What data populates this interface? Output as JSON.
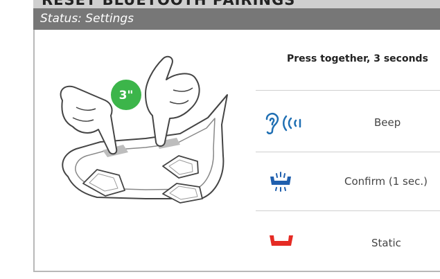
{
  "header": {
    "title": "RESET BLUETOOTH PAIRINGS",
    "status": "Status: Settings"
  },
  "illustration": {
    "timer_badge": "3\"",
    "badge_color": "#3cb54a"
  },
  "instruction": "Press together, 3 seconds",
  "rows": [
    {
      "icon": "ear-beep-icon",
      "label": "Beep",
      "icon_color": "#1f6fb3"
    },
    {
      "icon": "led-blink-blue-icon",
      "label": "Confirm (1 sec.)",
      "icon_color": "#1f5fae"
    },
    {
      "icon": "led-static-red-icon",
      "label": "Static",
      "icon_color": "#e52b24"
    }
  ]
}
